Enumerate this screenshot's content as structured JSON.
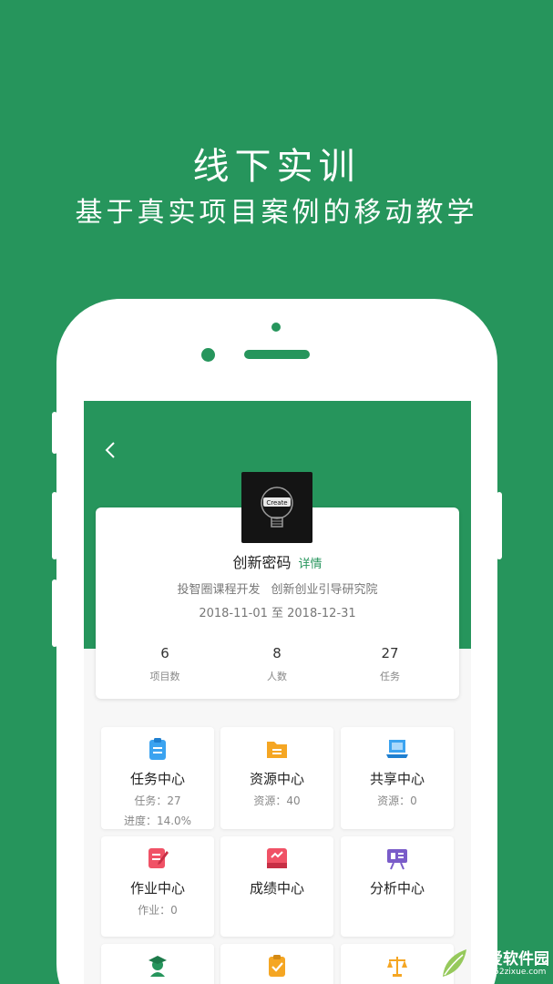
{
  "promo": {
    "headline": "线下实训",
    "subheadline": "基于真实项目案例的移动教学"
  },
  "project": {
    "name": "创新密码",
    "detail_link": "详情",
    "org_1": "投智圈课程开发",
    "org_2": "创新创业引导研究院",
    "date_range": "2018-11-01 至 2018-12-31",
    "logo_text": "Create"
  },
  "stats": [
    {
      "value": "6",
      "label": "项目数"
    },
    {
      "value": "8",
      "label": "人数"
    },
    {
      "value": "27",
      "label": "任务"
    }
  ],
  "tiles": [
    {
      "title": "任务中心",
      "line1": "任务：27",
      "line2": "进度：14.0%",
      "icon": "clipboard-icon"
    },
    {
      "title": "资源中心",
      "line1": "资源：40",
      "line2": "",
      "icon": "folder-icon"
    },
    {
      "title": "共享中心",
      "line1": "资源：0",
      "line2": "",
      "icon": "laptop-icon"
    },
    {
      "title": "作业中心",
      "line1": "作业：0",
      "line2": "",
      "icon": "notebook-pen-icon"
    },
    {
      "title": "成绩中心",
      "line1": "",
      "line2": "",
      "icon": "score-card-icon"
    },
    {
      "title": "分析中心",
      "line1": "",
      "line2": "",
      "icon": "presentation-board-icon"
    }
  ],
  "bottom_row_icons": [
    "graduate-icon",
    "checklist-icon",
    "scales-icon"
  ],
  "watermark": {
    "title": "吾爱软件园",
    "url": "www.52zixue.com"
  },
  "colors": {
    "brand_green": "#26955c",
    "accent_blue": "#3ba3f0",
    "accent_orange": "#f5a623",
    "accent_red": "#f05266",
    "accent_purple": "#7a5cc9"
  }
}
